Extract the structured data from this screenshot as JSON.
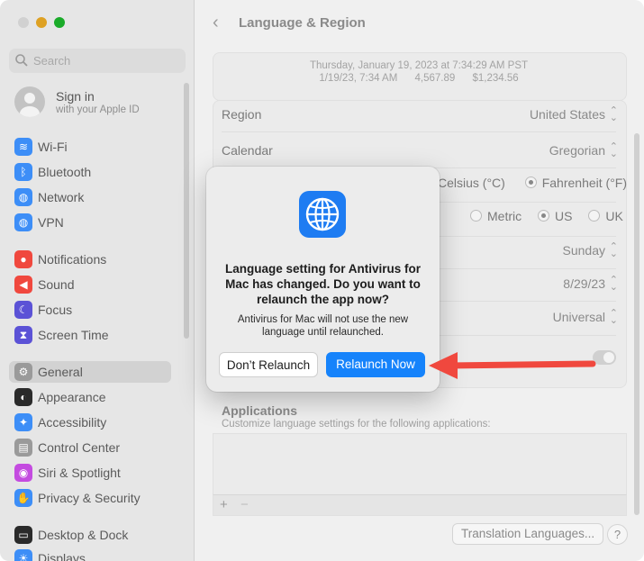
{
  "window": {
    "title": "Language & Region",
    "colors": {
      "close": "#e0443e",
      "minimize": "#dea123",
      "zoom": "#1aab29",
      "accent": "#1683fb",
      "arrow": "#f0483e"
    }
  },
  "sidebar": {
    "search_placeholder": "Search",
    "account": {
      "name": "Sign in",
      "sub": "with your Apple ID"
    },
    "items": [
      {
        "label": "Wi-Fi",
        "icon": "wifi-icon",
        "color": "#3d8ef7"
      },
      {
        "label": "Bluetooth",
        "icon": "bluetooth-icon",
        "color": "#3d8ef7"
      },
      {
        "label": "Network",
        "icon": "globe-icon",
        "color": "#3d8ef7"
      },
      {
        "label": "VPN",
        "icon": "vpn-icon",
        "color": "#3d8ef7"
      },
      {
        "label": "Notifications",
        "icon": "bell-icon",
        "color": "#f0483e"
      },
      {
        "label": "Sound",
        "icon": "speaker-icon",
        "color": "#f0483e"
      },
      {
        "label": "Focus",
        "icon": "moon-icon",
        "color": "#5b52d6"
      },
      {
        "label": "Screen Time",
        "icon": "hourglass-icon",
        "color": "#5b52d6"
      },
      {
        "label": "General",
        "icon": "gear-icon",
        "color": "#9a9a9a"
      },
      {
        "label": "Appearance",
        "icon": "appearance-icon",
        "color": "#2a2a2a"
      },
      {
        "label": "Accessibility",
        "icon": "accessibility-icon",
        "color": "#3d8ef7"
      },
      {
        "label": "Control Center",
        "icon": "control-center-icon",
        "color": "#9a9a9a"
      },
      {
        "label": "Siri & Spotlight",
        "icon": "siri-icon",
        "color": "#c44be0"
      },
      {
        "label": "Privacy & Security",
        "icon": "hand-icon",
        "color": "#3d8ef7"
      },
      {
        "label": "Desktop & Dock",
        "icon": "dock-icon",
        "color": "#2a2a2a"
      },
      {
        "label": "Displays",
        "icon": "display-icon",
        "color": "#3d8ef7"
      }
    ]
  },
  "main": {
    "sample": {
      "line1": "Thursday, January 19, 2023 at 7:34:29 AM PST",
      "date": "1/19/23, 7:34 AM",
      "number": "4,567.89",
      "currency": "$1,234.56"
    },
    "region": {
      "label": "Region",
      "value": "United States"
    },
    "calendar": {
      "label": "Calendar",
      "value": "Gregorian"
    },
    "temperature": {
      "opt1": "Celsius (°C)",
      "opt2": "Fahrenheit (°F)"
    },
    "measurement": {
      "opt1": "Metric",
      "opt2": "US",
      "opt3": "UK"
    },
    "first_day": {
      "value": "Sunday"
    },
    "date_format": {
      "value": "8/29/23"
    },
    "number_format": {
      "value": "Universal"
    },
    "applications": {
      "title": "Applications",
      "subtitle": "Customize language settings for the following applications:",
      "add": "+",
      "remove": "−"
    },
    "translation_button": "Translation Languages...",
    "help": "?"
  },
  "dialog": {
    "title": "Language setting for Antivirus for Mac has changed. Do you want to relaunch the app now?",
    "message": "Antivirus for Mac will not use the new language until relaunched.",
    "secondary_button": "Don’t Relaunch",
    "primary_button": "Relaunch Now"
  }
}
